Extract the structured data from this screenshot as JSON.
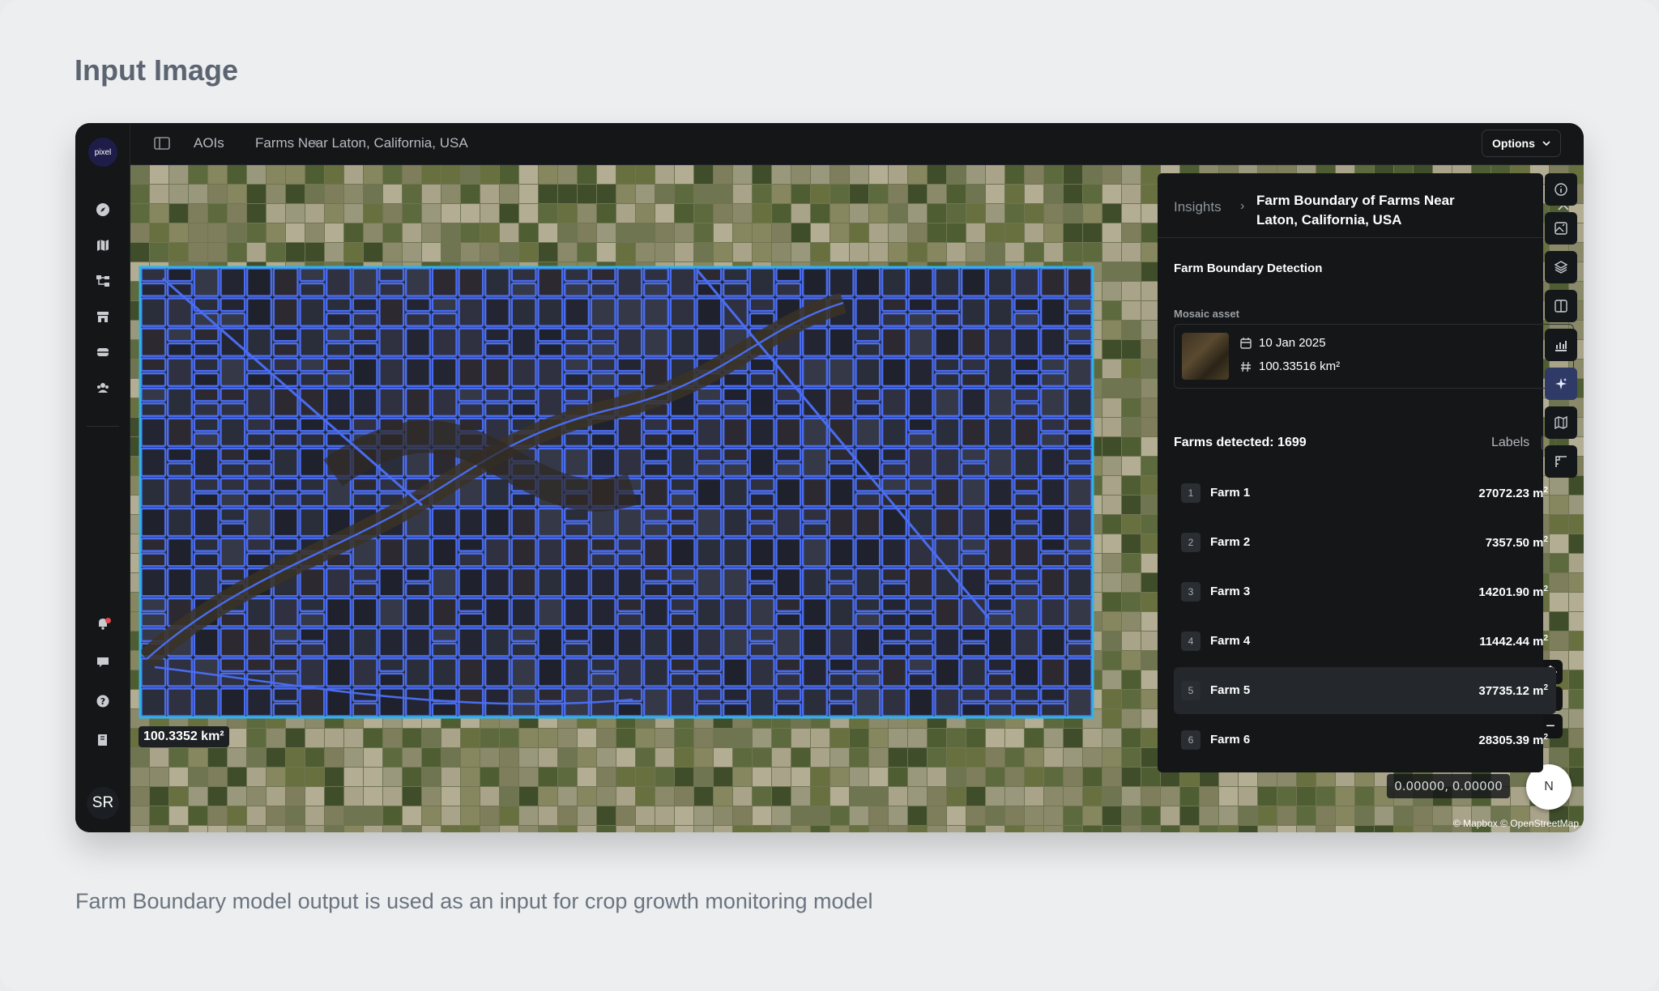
{
  "slide": {
    "title": "Input Image",
    "caption": "Farm Boundary model output is used as an input for crop growth monitoring model"
  },
  "app": {
    "logo_text": "pixel",
    "avatar_initials": "SR",
    "breadcrumb": [
      "AOIs",
      "Farms Near Laton, California, USA"
    ],
    "options_label": "Options"
  },
  "map": {
    "aoi_area": "100.3352 km²",
    "coordinates": "0.00000, 0.00000",
    "attribution": "© Mapbox © OpenStreetMap",
    "compass_label": "N",
    "zoom_in": "+",
    "zoom_out": "−"
  },
  "panel": {
    "breadcrumb_root": "Insights",
    "title": "Farm Boundary of Farms Near Laton, California, USA",
    "section_title": "Farm Boundary Detection",
    "mosaic_label": "Mosaic asset",
    "mosaic_date": "10 Jan 2025",
    "mosaic_area": "100.33516 km²",
    "farms_detected": "Farms detected: 1699",
    "labels_toggle": "Labels",
    "farms": [
      {
        "num": "1",
        "name": "Farm 1",
        "area": "27072.23 m",
        "unit_sup": "2"
      },
      {
        "num": "2",
        "name": "Farm 2",
        "area": "7357.50 m",
        "unit_sup": "2"
      },
      {
        "num": "3",
        "name": "Farm 3",
        "area": "14201.90 m",
        "unit_sup": "2"
      },
      {
        "num": "4",
        "name": "Farm 4",
        "area": "11442.44 m",
        "unit_sup": "2"
      },
      {
        "num": "5",
        "name": "Farm 5",
        "area": "37735.12 m",
        "unit_sup": "2"
      },
      {
        "num": "6",
        "name": "Farm 6",
        "area": "28305.39 m",
        "unit_sup": "2"
      }
    ]
  },
  "colors": {
    "boundary": "#4a6cf0",
    "aoi_outline": "#2fb3e6",
    "field_dark": "#262a33",
    "active_tool": "#303a66"
  }
}
